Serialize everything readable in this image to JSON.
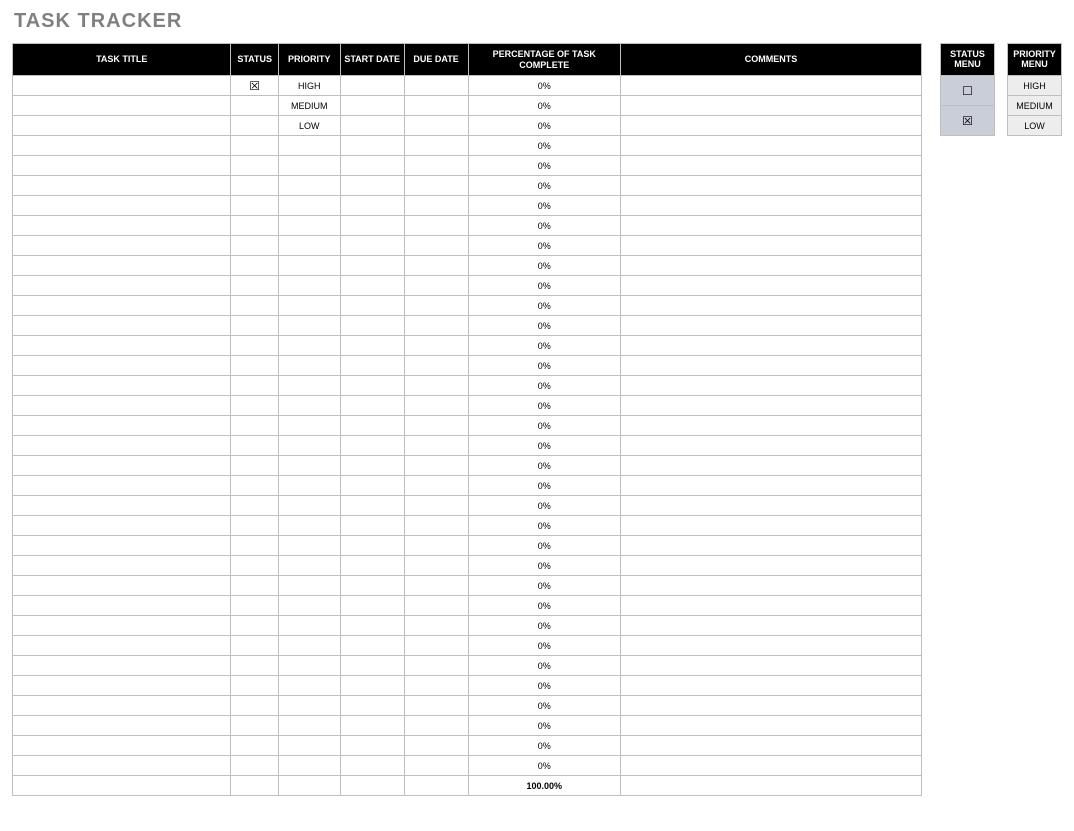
{
  "title": "TASK TRACKER",
  "columns": {
    "task_title": "TASK TITLE",
    "status": "STATUS",
    "priority": "PRIORITY",
    "start_date": "START DATE",
    "due_date": "DUE DATE",
    "pct_complete": "PERCENTAGE OF TASK COMPLETE",
    "comments": "COMMENTS"
  },
  "rows": [
    {
      "task_title": "",
      "status": "☒",
      "priority": "HIGH",
      "start_date": "",
      "due_date": "",
      "pct": "0%",
      "comments": ""
    },
    {
      "task_title": "",
      "status": "",
      "priority": "MEDIUM",
      "start_date": "",
      "due_date": "",
      "pct": "0%",
      "comments": ""
    },
    {
      "task_title": "",
      "status": "",
      "priority": "LOW",
      "start_date": "",
      "due_date": "",
      "pct": "0%",
      "comments": ""
    },
    {
      "task_title": "",
      "status": "",
      "priority": "",
      "start_date": "",
      "due_date": "",
      "pct": "0%",
      "comments": ""
    },
    {
      "task_title": "",
      "status": "",
      "priority": "",
      "start_date": "",
      "due_date": "",
      "pct": "0%",
      "comments": ""
    },
    {
      "task_title": "",
      "status": "",
      "priority": "",
      "start_date": "",
      "due_date": "",
      "pct": "0%",
      "comments": ""
    },
    {
      "task_title": "",
      "status": "",
      "priority": "",
      "start_date": "",
      "due_date": "",
      "pct": "0%",
      "comments": ""
    },
    {
      "task_title": "",
      "status": "",
      "priority": "",
      "start_date": "",
      "due_date": "",
      "pct": "0%",
      "comments": ""
    },
    {
      "task_title": "",
      "status": "",
      "priority": "",
      "start_date": "",
      "due_date": "",
      "pct": "0%",
      "comments": ""
    },
    {
      "task_title": "",
      "status": "",
      "priority": "",
      "start_date": "",
      "due_date": "",
      "pct": "0%",
      "comments": ""
    },
    {
      "task_title": "",
      "status": "",
      "priority": "",
      "start_date": "",
      "due_date": "",
      "pct": "0%",
      "comments": ""
    },
    {
      "task_title": "",
      "status": "",
      "priority": "",
      "start_date": "",
      "due_date": "",
      "pct": "0%",
      "comments": ""
    },
    {
      "task_title": "",
      "status": "",
      "priority": "",
      "start_date": "",
      "due_date": "",
      "pct": "0%",
      "comments": ""
    },
    {
      "task_title": "",
      "status": "",
      "priority": "",
      "start_date": "",
      "due_date": "",
      "pct": "0%",
      "comments": ""
    },
    {
      "task_title": "",
      "status": "",
      "priority": "",
      "start_date": "",
      "due_date": "",
      "pct": "0%",
      "comments": ""
    },
    {
      "task_title": "",
      "status": "",
      "priority": "",
      "start_date": "",
      "due_date": "",
      "pct": "0%",
      "comments": ""
    },
    {
      "task_title": "",
      "status": "",
      "priority": "",
      "start_date": "",
      "due_date": "",
      "pct": "0%",
      "comments": ""
    },
    {
      "task_title": "",
      "status": "",
      "priority": "",
      "start_date": "",
      "due_date": "",
      "pct": "0%",
      "comments": ""
    },
    {
      "task_title": "",
      "status": "",
      "priority": "",
      "start_date": "",
      "due_date": "",
      "pct": "0%",
      "comments": ""
    },
    {
      "task_title": "",
      "status": "",
      "priority": "",
      "start_date": "",
      "due_date": "",
      "pct": "0%",
      "comments": ""
    },
    {
      "task_title": "",
      "status": "",
      "priority": "",
      "start_date": "",
      "due_date": "",
      "pct": "0%",
      "comments": ""
    },
    {
      "task_title": "",
      "status": "",
      "priority": "",
      "start_date": "",
      "due_date": "",
      "pct": "0%",
      "comments": ""
    },
    {
      "task_title": "",
      "status": "",
      "priority": "",
      "start_date": "",
      "due_date": "",
      "pct": "0%",
      "comments": ""
    },
    {
      "task_title": "",
      "status": "",
      "priority": "",
      "start_date": "",
      "due_date": "",
      "pct": "0%",
      "comments": ""
    },
    {
      "task_title": "",
      "status": "",
      "priority": "",
      "start_date": "",
      "due_date": "",
      "pct": "0%",
      "comments": ""
    },
    {
      "task_title": "",
      "status": "",
      "priority": "",
      "start_date": "",
      "due_date": "",
      "pct": "0%",
      "comments": ""
    },
    {
      "task_title": "",
      "status": "",
      "priority": "",
      "start_date": "",
      "due_date": "",
      "pct": "0%",
      "comments": ""
    },
    {
      "task_title": "",
      "status": "",
      "priority": "",
      "start_date": "",
      "due_date": "",
      "pct": "0%",
      "comments": ""
    },
    {
      "task_title": "",
      "status": "",
      "priority": "",
      "start_date": "",
      "due_date": "",
      "pct": "0%",
      "comments": ""
    },
    {
      "task_title": "",
      "status": "",
      "priority": "",
      "start_date": "",
      "due_date": "",
      "pct": "0%",
      "comments": ""
    },
    {
      "task_title": "",
      "status": "",
      "priority": "",
      "start_date": "",
      "due_date": "",
      "pct": "0%",
      "comments": ""
    },
    {
      "task_title": "",
      "status": "",
      "priority": "",
      "start_date": "",
      "due_date": "",
      "pct": "0%",
      "comments": ""
    },
    {
      "task_title": "",
      "status": "",
      "priority": "",
      "start_date": "",
      "due_date": "",
      "pct": "0%",
      "comments": ""
    },
    {
      "task_title": "",
      "status": "",
      "priority": "",
      "start_date": "",
      "due_date": "",
      "pct": "0%",
      "comments": ""
    },
    {
      "task_title": "",
      "status": "",
      "priority": "",
      "start_date": "",
      "due_date": "",
      "pct": "0%",
      "comments": ""
    }
  ],
  "total_pct": "100.00%",
  "status_menu": {
    "header": "STATUS MENU",
    "options": [
      "☐",
      "☒"
    ]
  },
  "priority_menu": {
    "header": "PRIORITY MENU",
    "options": [
      "HIGH",
      "MEDIUM",
      "LOW"
    ]
  }
}
